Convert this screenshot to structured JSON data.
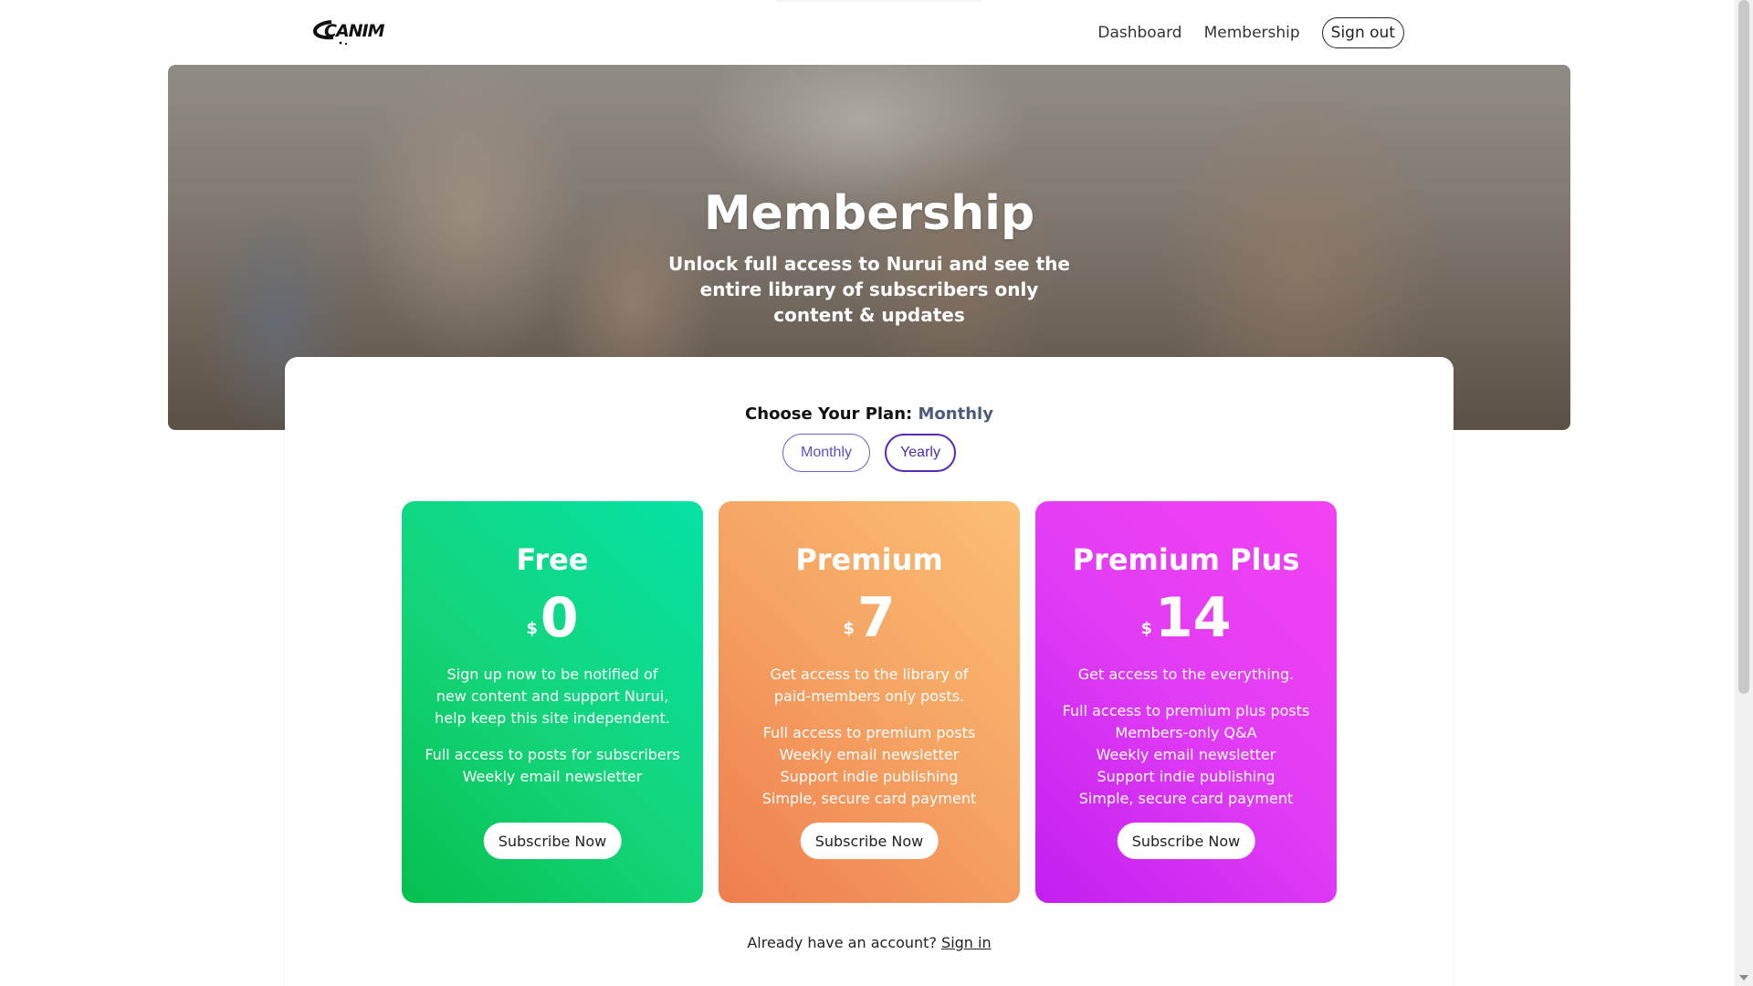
{
  "header": {
    "logo_text": "CANIM",
    "nav": {
      "dashboard": "Dashboard",
      "membership": "Membership",
      "signout": "Sign out"
    }
  },
  "hero": {
    "title": "Membership",
    "subtitle": "Unlock full access to Nurui and see the entire library of subscribers only content & updates"
  },
  "plan_selector": {
    "label": "Choose Your Plan:",
    "selected": "Monthly",
    "options": [
      "Monthly",
      "Yearly"
    ]
  },
  "tiers": [
    {
      "name": "Free",
      "currency": "$",
      "price": "0",
      "description": "Sign up now to be notified of new content and support Nurui, help keep this site independent.",
      "features": [
        "Full access to posts for subscribers",
        "Weekly email newsletter"
      ],
      "cta": "Subscribe Now",
      "color": "#13d479"
    },
    {
      "name": "Premium",
      "currency": "$",
      "price": "7",
      "description": "Get access to the library of paid-members only posts.",
      "features": [
        "Full access to premium posts",
        "Weekly email newsletter",
        "Support indie publishing",
        "Simple, secure card payment"
      ],
      "cta": "Subscribe Now",
      "color": "#f5a262"
    },
    {
      "name": "Premium Plus",
      "currency": "$",
      "price": "14",
      "description": "Get access to the everything.",
      "features": [
        "Full access to premium plus posts",
        "Members-only Q&A",
        "Weekly email newsletter",
        "Support indie publishing",
        "Simple, secure card payment"
      ],
      "cta": "Subscribe Now",
      "color": "#e13cf5"
    }
  ],
  "footer": {
    "account_prompt": "Already have an account?",
    "signin": "Sign in"
  },
  "colors": {
    "accent": "#5b50c8",
    "selected_plan_text": "#4a5c7a"
  }
}
